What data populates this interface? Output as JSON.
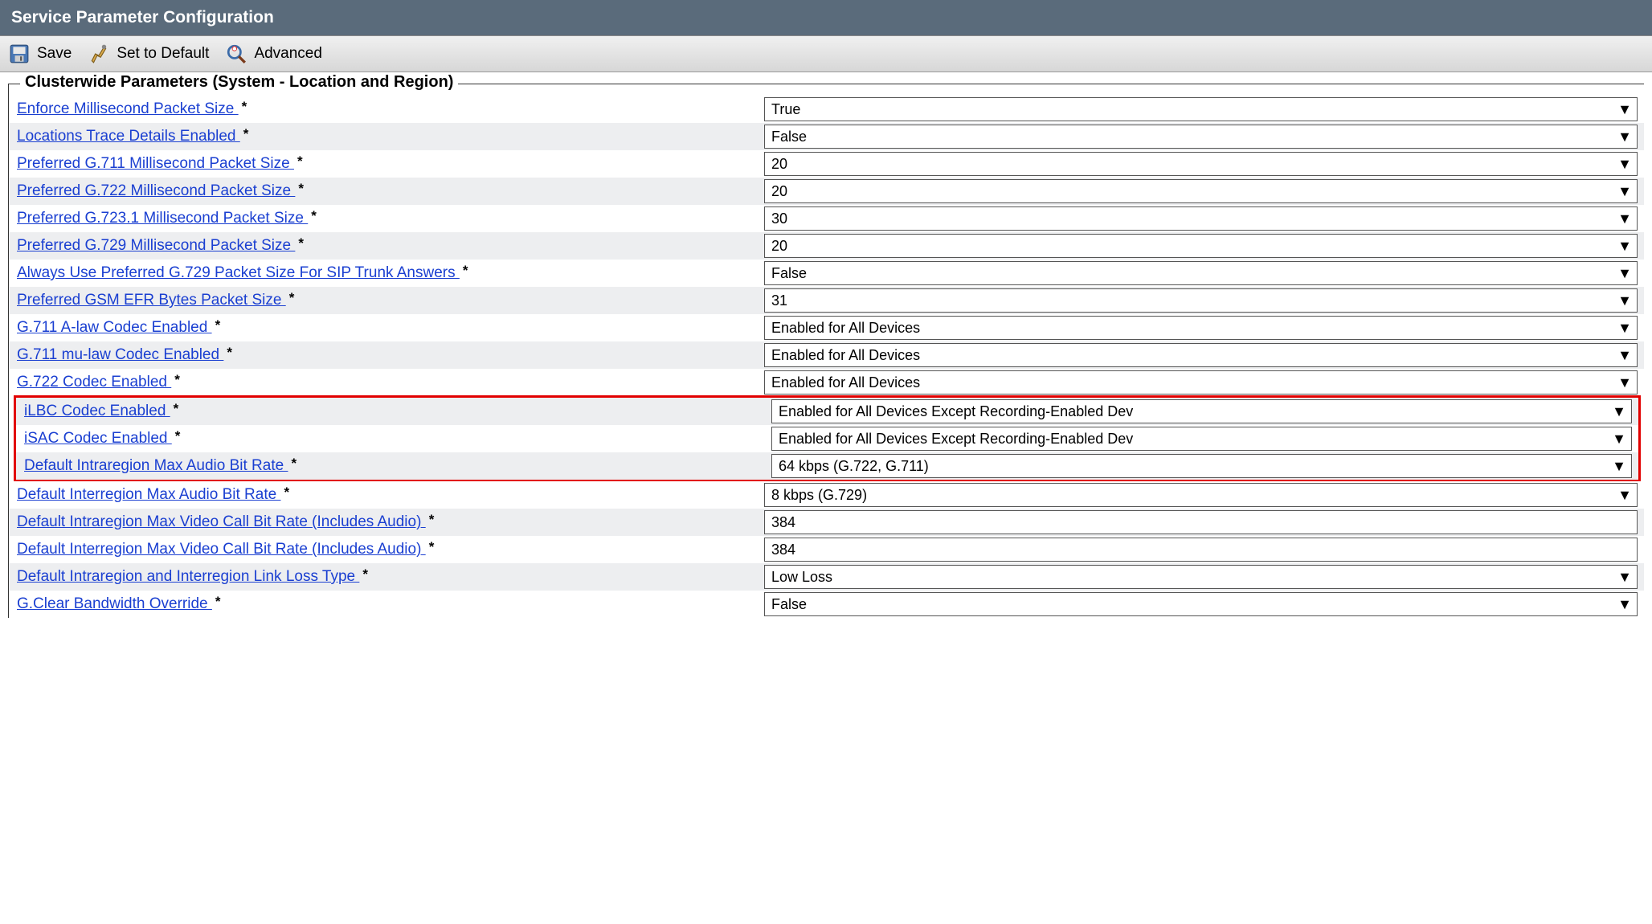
{
  "header": {
    "title": "Service Parameter Configuration"
  },
  "toolbar": {
    "save": "Save",
    "set_default": "Set to Default",
    "advanced": "Advanced"
  },
  "section": {
    "legend": "Clusterwide Parameters (System - Location and Region)"
  },
  "params": [
    {
      "label": "Enforce Millisecond Packet Size",
      "value": "True",
      "type": "select"
    },
    {
      "label": "Locations Trace Details Enabled",
      "value": "False",
      "type": "select"
    },
    {
      "label": "Preferred G.711 Millisecond Packet Size",
      "value": "20",
      "type": "select"
    },
    {
      "label": "Preferred G.722 Millisecond Packet Size",
      "value": "20",
      "type": "select"
    },
    {
      "label": "Preferred G.723.1 Millisecond Packet Size",
      "value": "30",
      "type": "select"
    },
    {
      "label": "Preferred G.729 Millisecond Packet Size",
      "value": "20",
      "type": "select"
    },
    {
      "label": "Always Use Preferred G.729 Packet Size For SIP Trunk Answers",
      "value": "False",
      "type": "select"
    },
    {
      "label": "Preferred GSM EFR Bytes Packet Size",
      "value": "31",
      "type": "select"
    },
    {
      "label": "G.711 A-law Codec Enabled",
      "value": "Enabled for All Devices",
      "type": "select"
    },
    {
      "label": "G.711 mu-law Codec Enabled",
      "value": "Enabled for All Devices",
      "type": "select"
    },
    {
      "label": "G.722 Codec Enabled",
      "value": "Enabled for All Devices",
      "type": "select"
    },
    {
      "label": "iLBC Codec Enabled",
      "value": "Enabled for All Devices Except Recording-Enabled Dev",
      "type": "select"
    },
    {
      "label": "iSAC Codec Enabled",
      "value": "Enabled for All Devices Except Recording-Enabled Dev",
      "type": "select"
    },
    {
      "label": "Default Intraregion Max Audio Bit Rate",
      "value": "64 kbps (G.722, G.711)",
      "type": "select"
    },
    {
      "label": "Default Interregion Max Audio Bit Rate",
      "value": "8 kbps (G.729)",
      "type": "select"
    },
    {
      "label": "Default Intraregion Max Video Call Bit Rate (Includes Audio)",
      "value": "384",
      "type": "text"
    },
    {
      "label": "Default Interregion Max Video Call Bit Rate (Includes Audio)",
      "value": "384",
      "type": "text"
    },
    {
      "label": "Default Intraregion and Interregion Link Loss Type",
      "value": "Low Loss",
      "type": "select"
    },
    {
      "label": "G.Clear Bandwidth Override",
      "value": "False",
      "type": "select"
    }
  ],
  "highlight": {
    "start": 11,
    "end": 13
  }
}
